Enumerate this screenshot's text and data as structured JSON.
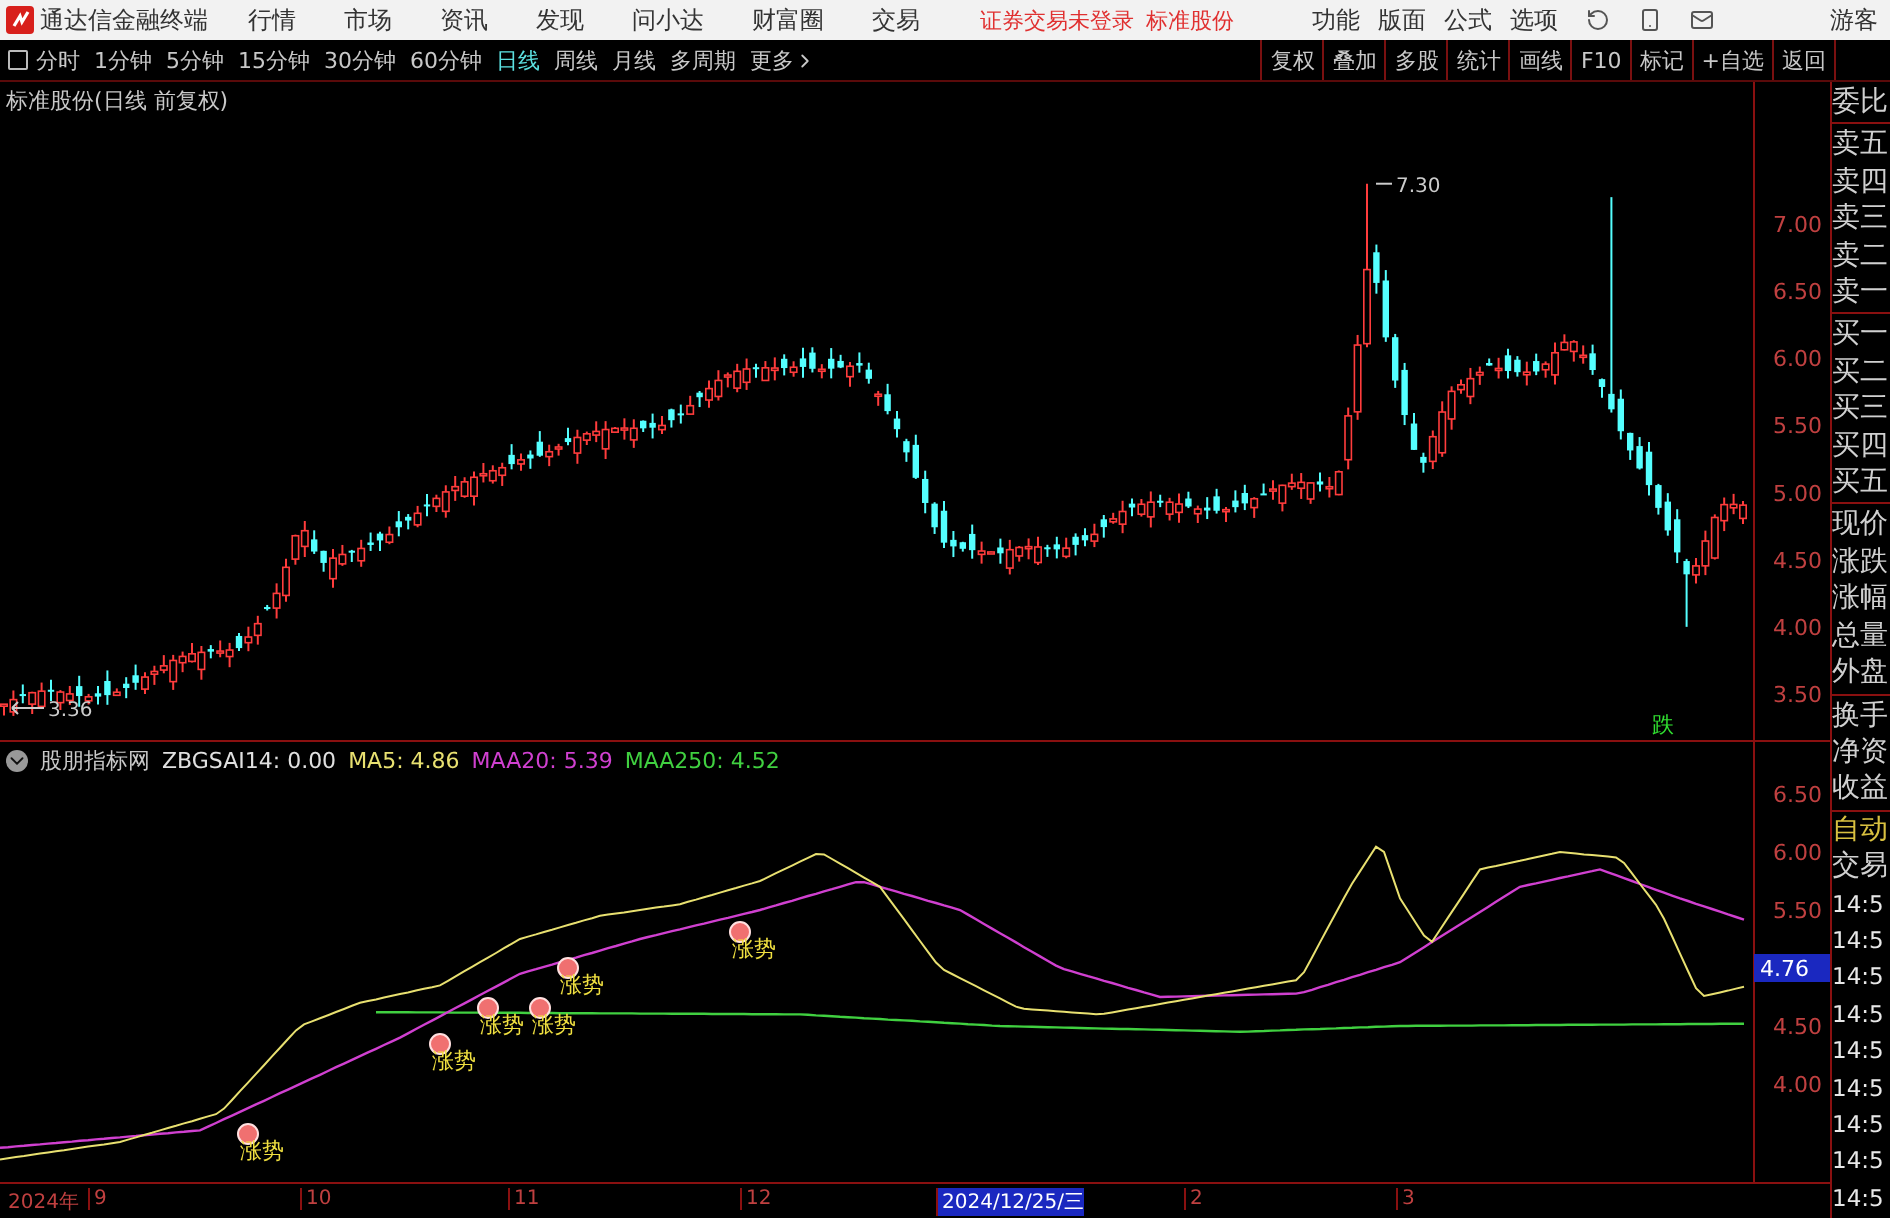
{
  "menu_bar": {
    "app_name": "通达信金融终端",
    "menus": [
      "行情",
      "市场",
      "资讯",
      "发现",
      "问小达",
      "财富圈",
      "交易"
    ],
    "notice": "证券交易未登录",
    "stock": "标准股份",
    "tools": [
      "功能",
      "版面",
      "公式",
      "选项"
    ],
    "user": "游客"
  },
  "period_tabs": [
    {
      "label": "分时",
      "selected": false
    },
    {
      "label": "1分钟",
      "selected": false
    },
    {
      "label": "5分钟",
      "selected": false
    },
    {
      "label": "15分钟",
      "selected": false
    },
    {
      "label": "30分钟",
      "selected": false
    },
    {
      "label": "60分钟",
      "selected": false
    },
    {
      "label": "日线",
      "selected": true
    },
    {
      "label": "周线",
      "selected": false
    },
    {
      "label": "月线",
      "selected": false
    },
    {
      "label": "多周期",
      "selected": false
    },
    {
      "label": "更多",
      "selected": false
    }
  ],
  "chart_actions": [
    "复权",
    "叠加",
    "多股",
    "统计",
    "画线",
    "F10",
    "标记",
    "+自选",
    "返回"
  ],
  "price_chart": {
    "title": "标准股份(日线 前复权)",
    "high_label": "7.30",
    "low_label": "3.36",
    "signal_label": "跌",
    "y_ticks": [
      "7.00",
      "6.50",
      "6.00",
      "5.50",
      "5.00",
      "4.50",
      "4.00",
      "3.50"
    ]
  },
  "indicator": {
    "name": "股朋指标网",
    "values": [
      {
        "text": "ZBGSAI14: 0.00",
        "color": "#e0e0e0"
      },
      {
        "text": "MA5: 4.86",
        "color": "#e8e070"
      },
      {
        "text": "MAA20: 5.39",
        "color": "#d040d0"
      },
      {
        "text": "MAA250: 4.52",
        "color": "#40d040"
      }
    ],
    "y_ticks": [
      "6.50",
      "6.00",
      "5.50",
      "4.50",
      "4.00"
    ],
    "current_value": "4.76",
    "signals": [
      "涨势",
      "涨势",
      "涨势",
      "涨势",
      "涨势",
      "涨势"
    ]
  },
  "x_axis": {
    "labels": [
      {
        "text": "2024年",
        "selected": false
      },
      {
        "text": "9",
        "selected": false
      },
      {
        "text": "10",
        "selected": false
      },
      {
        "text": "11",
        "selected": false
      },
      {
        "text": "12",
        "selected": false
      },
      {
        "text": "2024/12/25/三",
        "selected": true
      },
      {
        "text": "2",
        "selected": false
      },
      {
        "text": "3",
        "selected": false
      }
    ]
  },
  "side_panel": {
    "quote_groups": [
      [
        "委比"
      ],
      [
        "卖五",
        "卖四",
        "卖三",
        "卖二",
        "卖一"
      ],
      [
        "买一",
        "买二",
        "买三",
        "买四",
        "买五"
      ],
      [
        "现价",
        "涨跌",
        "涨幅",
        "总量",
        "外盘"
      ],
      [
        "换手",
        "净资",
        "收益"
      ]
    ],
    "mode": "自动",
    "trade_label": "交易",
    "trade_times": [
      "14:5",
      "14:5",
      "14:5",
      "14:5",
      "14:5",
      "14:5",
      "14:5",
      "14:5",
      "14:5"
    ]
  }
}
